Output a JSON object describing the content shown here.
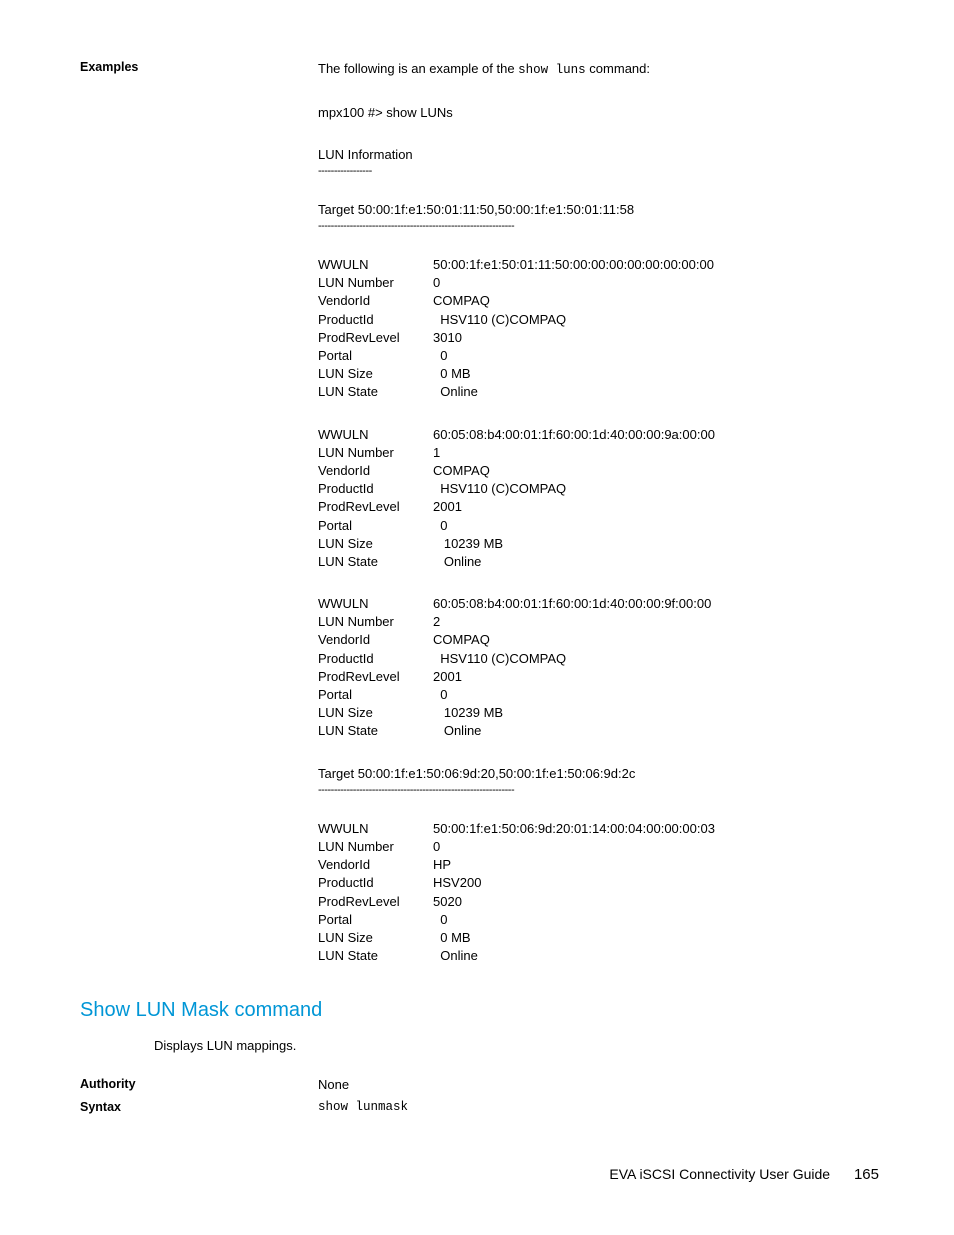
{
  "examples": {
    "label": "Examples",
    "intro_pre": "The following is an example of the ",
    "intro_mono": "show luns",
    "intro_post": " command:",
    "cmd": "mpx100 #> show LUNs",
    "header": "LUN Information",
    "dash1": "-----------------",
    "targets": [
      {
        "line": "Target   50:00:1f:e1:50:01:11:50,50:00:1f:e1:50:01:11:58",
        "dash": "--------------------------------------------------------------",
        "luns": [
          {
            "WWULN": "50:00:1f:e1:50:01:11:50:00:00:00:00:00:00:00:00",
            "LUN Number": "0",
            "VendorId": "COMPAQ",
            "ProductId": "  HSV110 (C)COMPAQ",
            "ProdRevLevel": "3010",
            "Portal": "  0",
            "LUN Size": "  0 MB",
            "LUN State": "  Online"
          },
          {
            "WWULN": "60:05:08:b4:00:01:1f:60:00:1d:40:00:00:9a:00:00",
            "LUN Number": "1",
            "VendorId": "COMPAQ",
            "ProductId": "  HSV110 (C)COMPAQ",
            "ProdRevLevel": "2001",
            "Portal": "  0",
            "LUN Size": "   10239 MB",
            "LUN State": "   Online"
          },
          {
            "WWULN": "60:05:08:b4:00:01:1f:60:00:1d:40:00:00:9f:00:00",
            "LUN Number": "2",
            "VendorId": "COMPAQ",
            "ProductId": "  HSV110 (C)COMPAQ",
            "ProdRevLevel": "2001",
            "Portal": "  0",
            "LUN Size": "   10239 MB",
            "LUN State": "   Online"
          }
        ]
      },
      {
        "line": "Target   50:00:1f:e1:50:06:9d:20,50:00:1f:e1:50:06:9d:2c",
        "dash": "--------------------------------------------------------------",
        "luns": [
          {
            "WWULN": "50:00:1f:e1:50:06:9d:20:01:14:00:04:00:00:00:03",
            "LUN Number": "0",
            "VendorId": "HP",
            "ProductId": "HSV200",
            "ProdRevLevel": "5020",
            "Portal": "  0",
            "LUN Size": "  0 MB",
            "LUN State": "  Online"
          }
        ]
      }
    ]
  },
  "showlunmask": {
    "heading": "Show LUN Mask command",
    "desc": "Displays LUN mappings.",
    "authority_label": "Authority",
    "authority_value": "None",
    "syntax_label": "Syntax",
    "syntax_value": "show lunmask"
  },
  "footer": {
    "title": "EVA iSCSI Connectivity User Guide",
    "page": "165"
  },
  "lun_fields": [
    "WWULN",
    "LUN Number",
    "VendorId",
    "ProductId",
    "ProdRevLevel",
    "Portal",
    "LUN Size",
    "LUN State"
  ]
}
